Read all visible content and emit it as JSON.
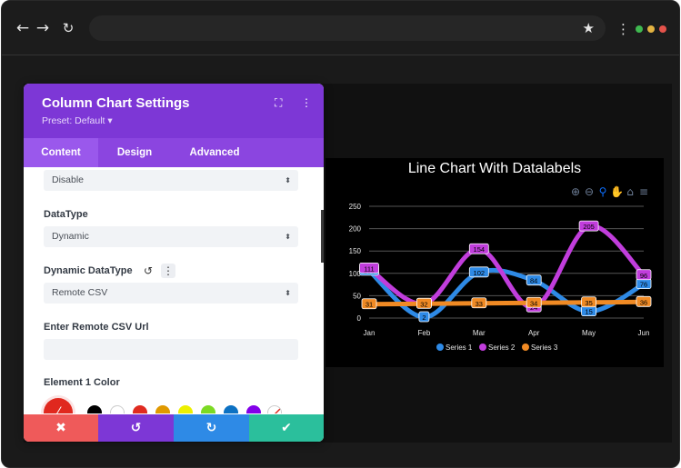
{
  "browser": {
    "back_icon": "←",
    "forward_icon": "→",
    "reload_icon": "↻",
    "bookmark_icon": "★",
    "menu_icon": "⋮",
    "url": "",
    "traffic_dots": [
      "#3fb950",
      "#e3b341",
      "#e5534b"
    ]
  },
  "panel": {
    "title": "Column Chart Settings",
    "preset": "Preset: Default ▾",
    "expand_icon": "⛶",
    "more_icon": "⋮",
    "tabs": [
      {
        "label": "Content",
        "active": true
      },
      {
        "label": "Design",
        "active": false
      },
      {
        "label": "Advanced",
        "active": false
      }
    ],
    "fields": {
      "top_select_value": "Disable",
      "datatype_label": "DataType",
      "datatype_value": "Dynamic",
      "dynamic_datatype_label": "Dynamic DataType",
      "reset_icon": "↺",
      "options_icon": "⋮",
      "dynamic_datatype_value": "Remote CSV",
      "csv_url_label": "Enter Remote CSV Url",
      "csv_url_value": "",
      "color_label": "Element 1 Color",
      "picker_icon": "⁄",
      "select_arrows": "⬍"
    },
    "swatches": [
      "#000000",
      "#ffffff",
      "#e02b20",
      "#e09900",
      "#edf000",
      "#7cda24",
      "#0c71c3",
      "#8300e9"
    ],
    "footer": {
      "cancel_icon": "✖",
      "undo_icon": "↺",
      "redo_icon": "↻",
      "save_icon": "✔",
      "colors": [
        "#ef5a5a",
        "#7d37d6",
        "#2e8ae6",
        "#2bbf9c"
      ]
    }
  },
  "chart_data": {
    "type": "line",
    "title": "Line Chart With Datalabels",
    "categories": [
      "Jan",
      "Feb",
      "Mar",
      "Apr",
      "May",
      "Jun"
    ],
    "ylim": [
      0,
      250
    ],
    "yticks": [
      0,
      50,
      100,
      150,
      200,
      250
    ],
    "series": [
      {
        "name": "Series 1",
        "color": "#2e8ae6",
        "values": [
          106,
          2,
          102,
          84,
          15,
          76
        ]
      },
      {
        "name": "Series 2",
        "color": "#c13ddc",
        "values": [
          111,
          32,
          154,
          24,
          205,
          96
        ]
      },
      {
        "name": "Series 3",
        "color": "#f08a24",
        "values": [
          31,
          32,
          33,
          34,
          35,
          36
        ]
      }
    ],
    "legend_position": "bottom",
    "grid": true,
    "toolbar_icons": [
      "zoom-in-icon",
      "zoom-out-icon",
      "zoom-icon",
      "pan-icon",
      "home-icon",
      "menu-icon"
    ]
  }
}
